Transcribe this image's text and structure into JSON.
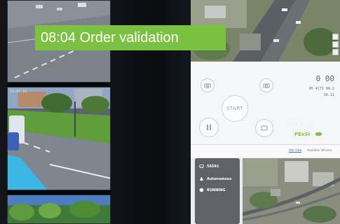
{
  "overlay": {
    "banner_text": "08:04 Order validation"
  },
  "cameras": [
    {
      "label": ""
    },
    {
      "label": "13:05:1D"
    },
    {
      "label": ""
    }
  ],
  "controls": {
    "start_label": "START",
    "readout_speed": "0 00",
    "readout_line2": "05 4(71 00.2",
    "readout_line3": "56.11",
    "brand": "PExSI"
  },
  "tabs": [
    {
      "label": "Site View",
      "active": true
    },
    {
      "label": "Available Vehicles",
      "active": false
    }
  ],
  "vehicle": {
    "id": "56591",
    "mode": "Autonomous",
    "status": "RUNNING"
  },
  "colors": {
    "accent_green": "#7cc242",
    "card_gray": "#5f6368"
  }
}
